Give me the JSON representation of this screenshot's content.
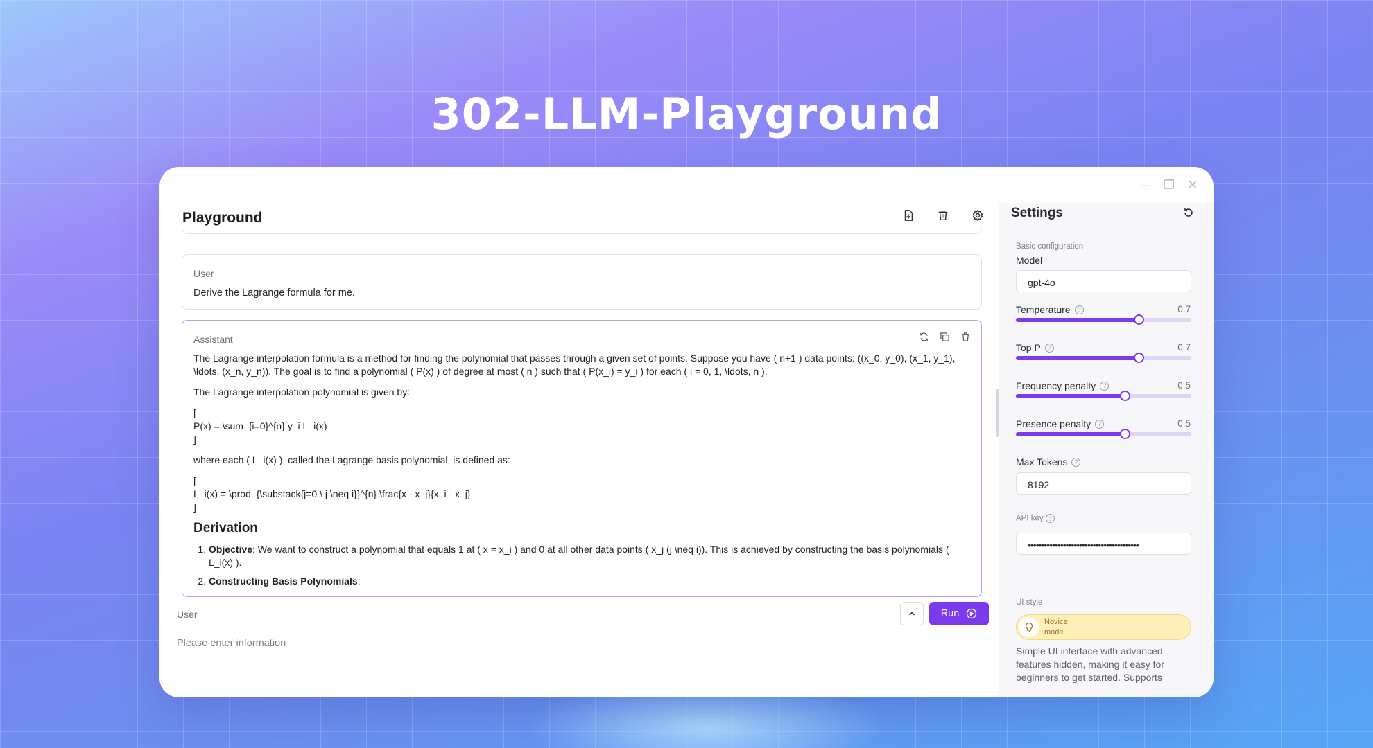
{
  "hero": {
    "title": "302-LLM-Playground"
  },
  "playground": {
    "title": "Playground",
    "messages": {
      "user": {
        "role": "User",
        "text": "Derive the Lagrange formula for me."
      },
      "assistant": {
        "role": "Assistant",
        "p1": "The Lagrange interpolation formula is a method for finding the polynomial that passes through a given set of points. Suppose you have ( n+1 ) data points: ((x_0, y_0), (x_1, y_1), \\ldots, (x_n, y_n)). The goal is to find a polynomial ( P(x) ) of degree at most ( n ) such that ( P(x_i) = y_i ) for each ( i = 0, 1, \\ldots, n ).",
        "p2": "The Lagrange interpolation polynomial is given by:",
        "eq1_open": "[",
        "eq1": "P(x) = \\sum_{i=0}^{n} y_i L_i(x)",
        "eq1_close": "]",
        "p3": "where each ( L_i(x) ), called the Lagrange basis polynomial, is defined as:",
        "eq2_open": "[",
        "eq2": "L_i(x) = \\prod_{\\substack{j=0 \\ j \\neq i}}^{n} \\frac{x - x_j}{x_i - x_j}",
        "eq2_close": "]",
        "heading": "Derivation",
        "item1_bold": "Objective",
        "item1_text": ": We want to construct a polynomial that equals 1 at ( x = x_i ) and 0 at all other data points ( x_j (j \\neq i)). This is achieved by constructing the basis polynomials ( L_i(x) ).",
        "item2_bold": "Constructing Basis Polynomials",
        "item2_text": ":"
      }
    },
    "composer": {
      "label": "User",
      "placeholder": "Please enter information",
      "run_label": "Run"
    }
  },
  "settings": {
    "title": "Settings",
    "basic_section": "Basic configuration",
    "model_label": "Model",
    "model_value": "gpt-4o",
    "temperature": {
      "label": "Temperature",
      "value": "0.7",
      "level": 0.7
    },
    "top_p": {
      "label": "Top P",
      "value": "0.7",
      "level": 0.7
    },
    "frequency_penalty": {
      "label": "Frequency penalty",
      "value": "0.5",
      "level": 0.62
    },
    "presence_penalty": {
      "label": "Presence penalty",
      "value": "0.5",
      "level": 0.62
    },
    "max_tokens": {
      "label": "Max Tokens",
      "value": "8192"
    },
    "api_key": {
      "label": "API key",
      "value": "•••••••••••••••••••••••••••••••••••••••••"
    },
    "ui_style": {
      "label": "UI style",
      "mode": "Novice mode",
      "description": "Simple UI interface with advanced features hidden, making it easy for beginners to get started. Supports"
    },
    "help_glyph": "?"
  },
  "colors": {
    "accent": "#7c3aed",
    "novice_bg": "#fdefb8"
  }
}
